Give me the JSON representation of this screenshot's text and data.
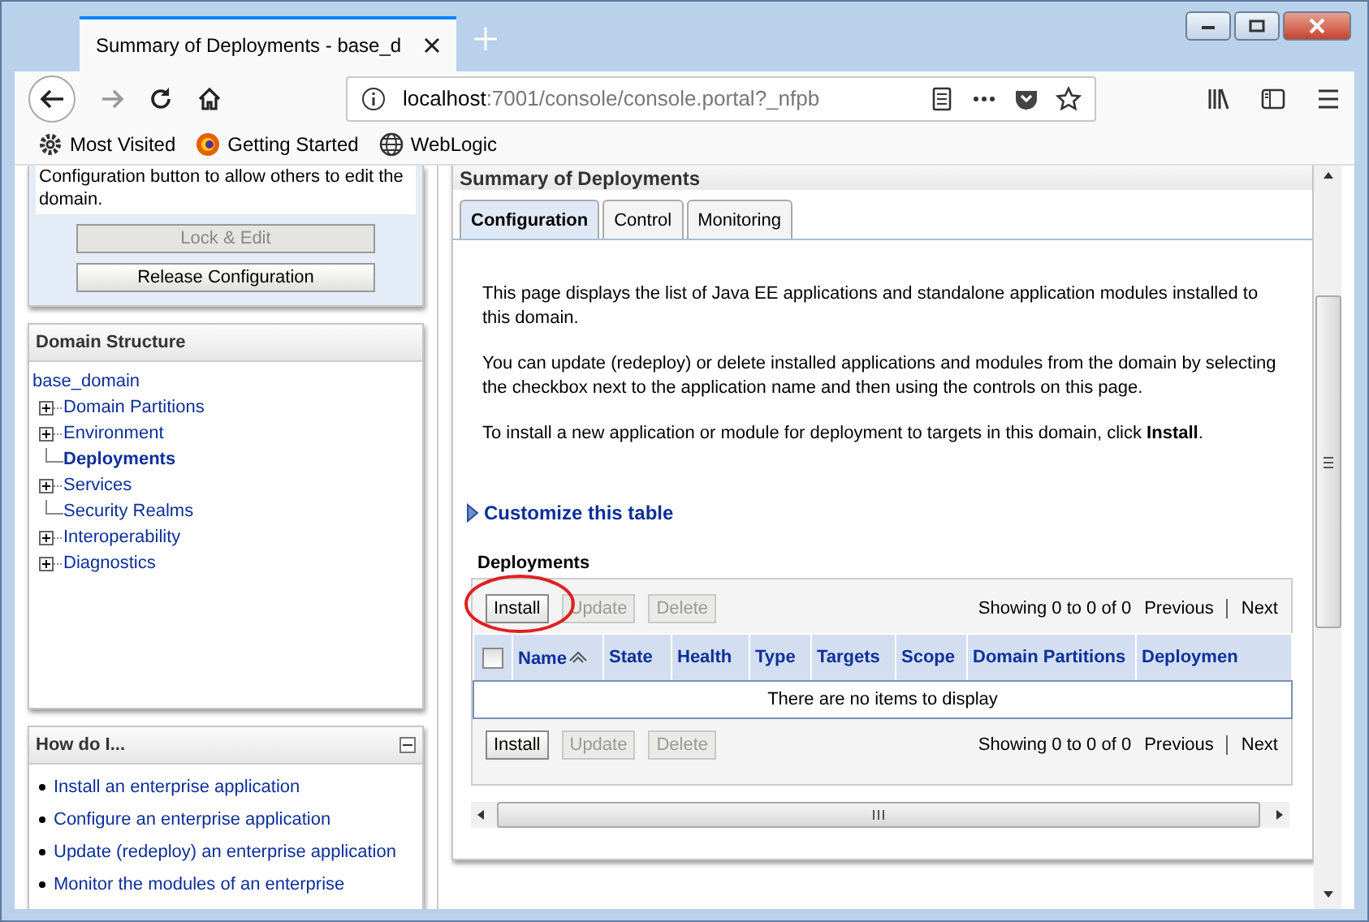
{
  "browser": {
    "tab_title": "Summary of Deployments - base_d",
    "url_host": "localhost",
    "url_path": ":7001/console/console.portal?_nfpb",
    "bookmarks": [
      {
        "kind": "gear",
        "label": "Most Visited"
      },
      {
        "kind": "firefox",
        "label": "Getting Started"
      },
      {
        "kind": "globe",
        "label": "WebLogic"
      }
    ]
  },
  "change_center": {
    "text": "Configuration button to allow others to edit the domain.",
    "buttons": [
      {
        "label": "Lock & Edit",
        "disabled": true
      },
      {
        "label": "Release Configuration",
        "disabled": false
      }
    ]
  },
  "domain_structure": {
    "title": "Domain Structure",
    "root": "base_domain",
    "children": [
      {
        "label": "Domain Partitions",
        "expandable": true,
        "selected": false
      },
      {
        "label": "Environment",
        "expandable": true,
        "selected": false
      },
      {
        "label": "Deployments",
        "expandable": false,
        "selected": true
      },
      {
        "label": "Services",
        "expandable": true,
        "selected": false
      },
      {
        "label": "Security Realms",
        "expandable": false,
        "selected": false
      },
      {
        "label": "Interoperability",
        "expandable": true,
        "selected": false
      },
      {
        "label": "Diagnostics",
        "expandable": true,
        "selected": false
      }
    ]
  },
  "how_do_i": {
    "title": "How do I...",
    "items": [
      "Install an enterprise application",
      "Configure an enterprise application",
      "Update (redeploy) an enterprise application",
      "Monitor the modules of an enterprise"
    ]
  },
  "summary": {
    "title": "Summary of Deployments",
    "tabs": [
      {
        "label": "Configuration",
        "selected": true
      },
      {
        "label": "Control",
        "selected": false
      },
      {
        "label": "Monitoring",
        "selected": false
      }
    ],
    "paragraphs": [
      "This page displays the list of Java EE applications and standalone application modules installed to this domain.",
      "You can update (redeploy) or delete installed applications and modules from the domain by selecting the checkbox next to the application name and then using the controls on this page.",
      "To install a new application or module for deployment to targets in this domain, click **Install**."
    ],
    "customize_link": "Customize this table",
    "deployments": {
      "title": "Deployments",
      "toolbars": [
        {
          "buttons": [
            {
              "label": "Install",
              "disabled": false,
              "highlighted": true
            },
            {
              "label": "Update",
              "disabled": true,
              "highlighted": false
            },
            {
              "label": "Delete",
              "disabled": true,
              "highlighted": false
            }
          ],
          "showing": "Showing 0 to 0 of 0",
          "previous": "Previous",
          "next": "Next"
        },
        {
          "buttons": [
            {
              "label": "Install",
              "disabled": false,
              "highlighted": false
            },
            {
              "label": "Update",
              "disabled": true,
              "highlighted": false
            },
            {
              "label": "Delete",
              "disabled": true,
              "highlighted": false
            }
          ],
          "showing": "Showing 0 to 0 of 0",
          "previous": "Previous",
          "next": "Next"
        }
      ],
      "select_all_checked": false,
      "columns": [
        {
          "label": "Name",
          "sorted": true
        },
        {
          "label": "State",
          "sorted": false
        },
        {
          "label": "Health",
          "sorted": false
        },
        {
          "label": "Type",
          "sorted": false
        },
        {
          "label": "Targets",
          "sorted": false
        },
        {
          "label": "Scope",
          "sorted": false
        },
        {
          "label": "Domain Partitions",
          "sorted": false
        },
        {
          "label": "Deploymen",
          "sorted": false
        }
      ],
      "empty_message": "There are no items to display"
    }
  }
}
